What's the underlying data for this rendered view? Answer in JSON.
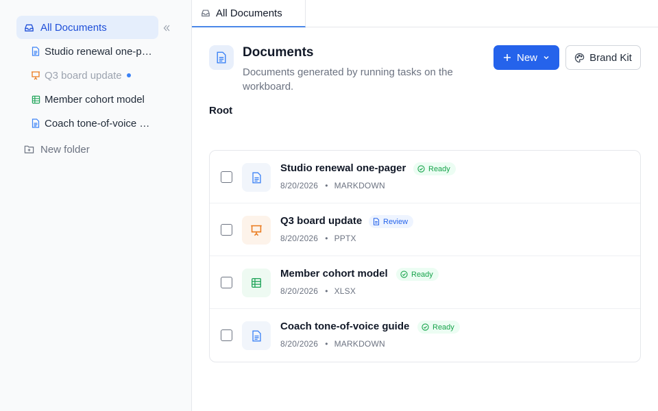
{
  "sidebar": {
    "all_documents": "All Documents",
    "items": [
      {
        "label": "Studio renewal one-pager",
        "type": "markdown"
      },
      {
        "label": "Q3 board update",
        "type": "pptx"
      },
      {
        "label": "Member cohort model",
        "type": "xlsx"
      },
      {
        "label": "Coach tone-of-voice guide",
        "type": "markdown"
      }
    ],
    "new_folder": "New folder"
  },
  "tabs": [
    {
      "label": "All Documents"
    }
  ],
  "header": {
    "title": "Documents",
    "subtitle": "Documents generated by running tasks on the workboard.",
    "new_button": "New",
    "brand_kit_button": "Brand Kit"
  },
  "breadcrumb": "Root",
  "documents": [
    {
      "title": "Studio renewal one-pager",
      "status": "Ready",
      "date": "8/20/2026",
      "format": "MARKDOWN",
      "icon": "document-icon"
    },
    {
      "title": "Q3 board update",
      "status": "Review",
      "date": "8/20/2026",
      "format": "PPTX",
      "icon": "presentation-icon"
    },
    {
      "title": "Member cohort model",
      "status": "Ready",
      "date": "8/20/2026",
      "format": "XLSX",
      "icon": "spreadsheet-icon"
    },
    {
      "title": "Coach tone-of-voice guide",
      "status": "Ready",
      "date": "8/20/2026",
      "format": "MARKDOWN",
      "icon": "document-icon"
    }
  ],
  "meta_separator": "•",
  "colors": {
    "accent": "#2563eb",
    "ready": "#16a34a",
    "review": "#2563eb",
    "pptx": "#ea7a1d",
    "xlsx": "#22a55b",
    "doc": "#3b82f6"
  }
}
